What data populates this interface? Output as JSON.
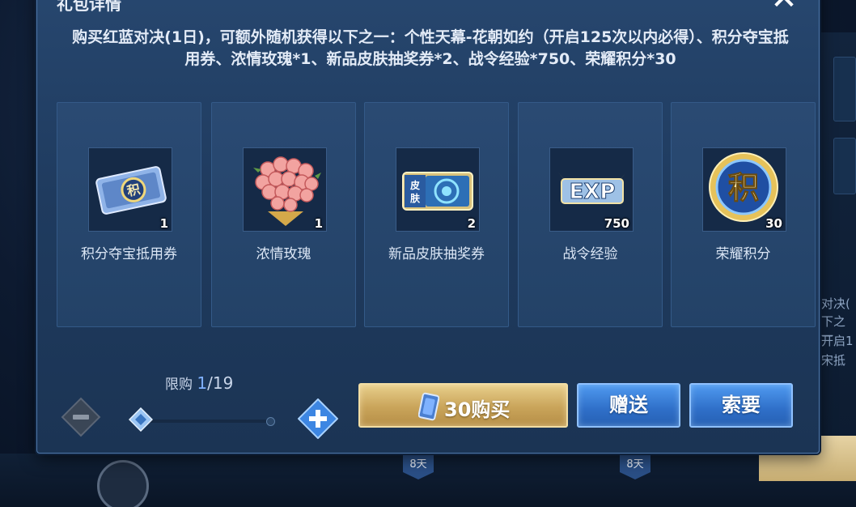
{
  "dialog": {
    "title": "礼包详情",
    "description": "购买红蓝对决(1日)，可额外随机获得以下之一：个性天幕-花朝如约（开启125次以内必得）、积分夺宝抵用券、浓情玫瑰*1、新品皮肤抽奖券*2、战令经验*750、荣耀积分*30"
  },
  "rewards": [
    {
      "name": "积分夺宝抵用券",
      "count": "1",
      "icon": "lottery-voucher-icon"
    },
    {
      "name": "浓情玫瑰",
      "count": "1",
      "icon": "rose-bouquet-icon"
    },
    {
      "name": "新品皮肤抽奖券",
      "count": "2",
      "icon": "skin-ticket-icon"
    },
    {
      "name": "战令经验",
      "count": "750",
      "icon": "exp-icon"
    },
    {
      "name": "荣耀积分",
      "count": "30",
      "icon": "honor-points-icon"
    }
  ],
  "purchase": {
    "limit_label": "限购",
    "limit_current": "1",
    "limit_total": "/19",
    "quantity_fraction": 0.0526,
    "buy_label": "30购买",
    "gift_label": "赠送",
    "request_label": "索要"
  },
  "background": {
    "side_text_1": "对决(",
    "side_text_2": "下之一",
    "side_text_3": "开启1",
    "side_text_4": "宋抵",
    "badge_1": "8天",
    "badge_2": "8天"
  },
  "colors": {
    "buy_gold": "#c9a45a",
    "action_blue": "#2f6fc8",
    "dialog_bg": "#1f3b5f"
  }
}
